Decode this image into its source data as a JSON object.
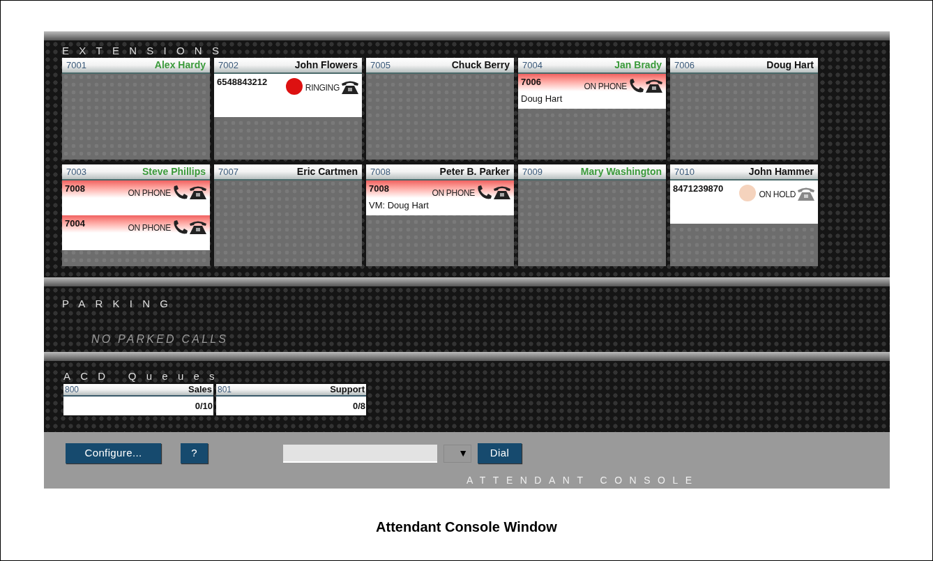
{
  "extensions": {
    "title": "EXTENSIONS",
    "items": [
      {
        "number": "7001",
        "name": "Alex Hardy",
        "color": "#3a9a3a"
      },
      {
        "number": "7002",
        "name": "John Flowers",
        "color": "#111111",
        "calls": [
          {
            "kind": "ringing",
            "number": "6548843212",
            "status": "RINGING"
          }
        ]
      },
      {
        "number": "7005",
        "name": "Chuck Berry",
        "color": "#111111"
      },
      {
        "number": "7004",
        "name": "Jan Brady",
        "color": "#3a9a3a",
        "calls": [
          {
            "kind": "on_phone",
            "number": "7006",
            "status": "ON PHONE",
            "detail": "Doug Hart"
          }
        ]
      },
      {
        "number": "7006",
        "name": "Doug Hart",
        "color": "#111111"
      },
      {
        "number": "7003",
        "name": "Steve Phillips",
        "color": "#3a9a3a",
        "calls": [
          {
            "kind": "on_phone",
            "number": "7008",
            "status": "ON PHONE"
          },
          {
            "kind": "on_phone",
            "number": "7004",
            "status": "ON PHONE"
          }
        ]
      },
      {
        "number": "7007",
        "name": "Eric Cartmen",
        "color": "#111111"
      },
      {
        "number": "7008",
        "name": "Peter B. Parker",
        "color": "#111111",
        "calls": [
          {
            "kind": "on_phone",
            "number": "7008",
            "status": "ON PHONE",
            "detail": "VM: Doug Hart"
          }
        ]
      },
      {
        "number": "7009",
        "name": "Mary Washington",
        "color": "#3a9a3a"
      },
      {
        "number": "7010",
        "name": "John Hammer",
        "color": "#111111",
        "calls": [
          {
            "kind": "on_hold",
            "number": "8471239870",
            "status": "ON HOLD"
          }
        ]
      }
    ]
  },
  "parking": {
    "title": "PARKING",
    "message": "NO PARKED CALLS"
  },
  "acd_queues": {
    "title": "ACD Queues",
    "items": [
      {
        "number": "800",
        "name": "Sales",
        "count": "0/10"
      },
      {
        "number": "801",
        "name": "Support",
        "count": "0/8"
      }
    ]
  },
  "toolbar": {
    "configure": "Configure...",
    "help": "?",
    "dropdown": "▼",
    "dial": "Dial"
  },
  "footer": "ATTENDANT CONSOLE",
  "caption": "Attendant Console Window"
}
